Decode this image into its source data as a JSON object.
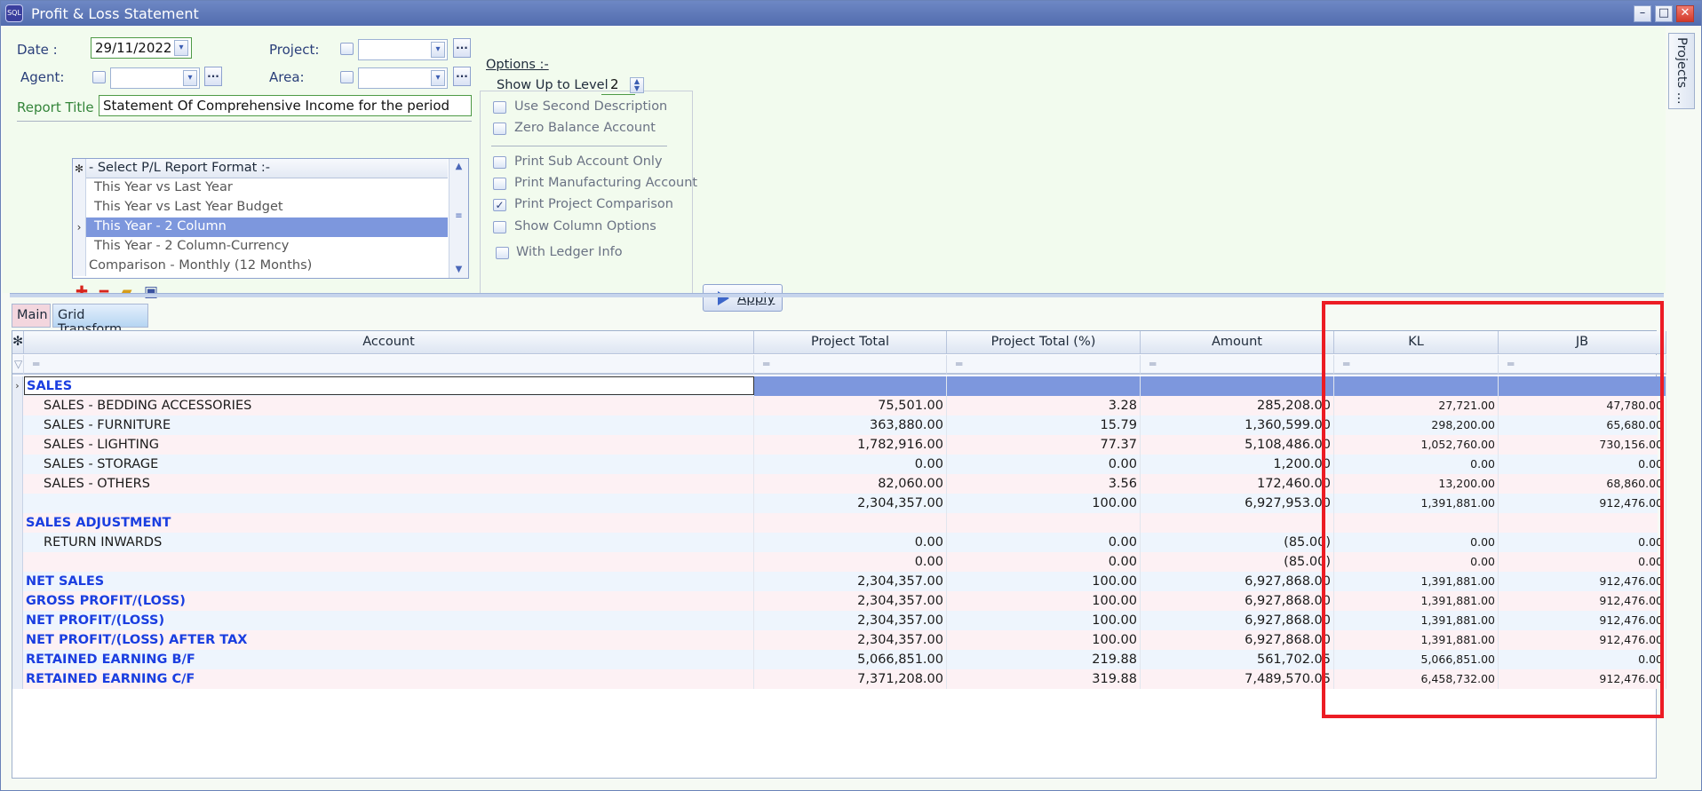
{
  "window": {
    "title": "Profit & Loss Statement",
    "app_icon_text": "SQL"
  },
  "form": {
    "date_label": "Date :",
    "date_value": "29/11/2022",
    "agent_label": "Agent:",
    "project_label": "Project:",
    "area_label": "Area:",
    "report_title_label": "Report Title :",
    "report_title_value": "Statement Of Comprehensive Income for the period"
  },
  "format_list": {
    "header": "- Select P/L Report Format :-",
    "items": [
      "This Year vs Last Year",
      "This Year vs Last Year Budget",
      "This Year - 2 Column",
      "This Year - 2 Column-Currency",
      "Comparison -  Monthly (12 Months)"
    ],
    "selected_index": 2
  },
  "options": {
    "title": "Options :-",
    "show_level_label": "Show Up to Level",
    "show_level_value": "2",
    "items": [
      {
        "label": "Use Second Description",
        "checked": false
      },
      {
        "label": "Zero Balance Account",
        "checked": false
      },
      {
        "label": "Print Sub Account Only",
        "checked": false
      },
      {
        "label": "Print Manufacturing Account",
        "checked": false
      },
      {
        "label": "Print Project Comparison",
        "checked": true
      },
      {
        "label": "Show Column Options",
        "checked": false
      },
      {
        "label": "With Ledger Info",
        "checked": false
      }
    ]
  },
  "apply_label": "Apply",
  "tabs": [
    "Main",
    "Grid Transform"
  ],
  "side_tab": "Projects ...",
  "grid": {
    "columns": [
      "Account",
      "Project Total",
      "Project Total (%)",
      "Amount",
      "KL",
      "JB"
    ],
    "rows": [
      {
        "account": "SALES",
        "style": "group-selected",
        "project_total": "",
        "pct": "",
        "amount": "",
        "kl": "",
        "jb": ""
      },
      {
        "account": "SALES - BEDDING ACCESSORIES",
        "style": "item",
        "project_total": "75,501.00",
        "pct": "3.28",
        "amount": "285,208.00",
        "kl": "27,721.00",
        "jb": "47,780.00"
      },
      {
        "account": "SALES - FURNITURE",
        "style": "item",
        "project_total": "363,880.00",
        "pct": "15.79",
        "amount": "1,360,599.00",
        "kl": "298,200.00",
        "jb": "65,680.00"
      },
      {
        "account": "SALES - LIGHTING",
        "style": "item",
        "project_total": "1,782,916.00",
        "pct": "77.37",
        "amount": "5,108,486.00",
        "kl": "1,052,760.00",
        "jb": "730,156.00"
      },
      {
        "account": "SALES - STORAGE",
        "style": "item",
        "project_total": "0.00",
        "pct": "0.00",
        "amount": "1,200.00",
        "kl": "0.00",
        "jb": "0.00"
      },
      {
        "account": "SALES - OTHERS",
        "style": "item",
        "project_total": "82,060.00",
        "pct": "3.56",
        "amount": "172,460.00",
        "kl": "13,200.00",
        "jb": "68,860.00"
      },
      {
        "account": "",
        "style": "total",
        "project_total": "2,304,357.00",
        "pct": "100.00",
        "amount": "6,927,953.00",
        "kl": "1,391,881.00",
        "jb": "912,476.00"
      },
      {
        "account": "SALES ADJUSTMENT",
        "style": "group",
        "project_total": "",
        "pct": "",
        "amount": "",
        "kl": "",
        "jb": ""
      },
      {
        "account": "RETURN INWARDS",
        "style": "item",
        "project_total": "0.00",
        "pct": "0.00",
        "amount": "(85.00)",
        "kl": "0.00",
        "jb": "0.00"
      },
      {
        "account": "",
        "style": "total",
        "project_total": "0.00",
        "pct": "0.00",
        "amount": "(85.00)",
        "kl": "0.00",
        "jb": "0.00"
      },
      {
        "account": "NET SALES",
        "style": "group",
        "project_total": "2,304,357.00",
        "pct": "100.00",
        "amount": "6,927,868.00",
        "kl": "1,391,881.00",
        "jb": "912,476.00"
      },
      {
        "account": "GROSS PROFIT/(LOSS)",
        "style": "group",
        "project_total": "2,304,357.00",
        "pct": "100.00",
        "amount": "6,927,868.00",
        "kl": "1,391,881.00",
        "jb": "912,476.00"
      },
      {
        "account": "NET PROFIT/(LOSS)",
        "style": "group",
        "project_total": "2,304,357.00",
        "pct": "100.00",
        "amount": "6,927,868.00",
        "kl": "1,391,881.00",
        "jb": "912,476.00"
      },
      {
        "account": "NET PROFIT/(LOSS) AFTER TAX",
        "style": "group",
        "project_total": "2,304,357.00",
        "pct": "100.00",
        "amount": "6,927,868.00",
        "kl": "1,391,881.00",
        "jb": "912,476.00"
      },
      {
        "account": "RETAINED EARNING B/F",
        "style": "group",
        "project_total": "5,066,851.00",
        "pct": "219.88",
        "amount": "561,702.05",
        "kl": "5,066,851.00",
        "jb": "0.00"
      },
      {
        "account": "RETAINED EARNING C/F",
        "style": "group",
        "project_total": "7,371,208.00",
        "pct": "319.88",
        "amount": "7,489,570.05",
        "kl": "6,458,732.00",
        "jb": "912,476.00"
      }
    ]
  },
  "colors": {
    "group_text": "#1a3ee0",
    "selected_row": "#7d97dd",
    "highlight_box": "#ec1c24"
  }
}
